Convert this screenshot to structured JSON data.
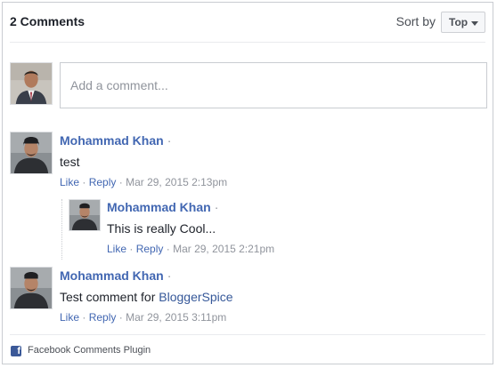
{
  "header": {
    "count_label": "2 Comments",
    "sort_by_label": "Sort by",
    "sort_selected": "Top"
  },
  "composer": {
    "placeholder": "Add a comment..."
  },
  "comments": [
    {
      "author": "Mohammad Khan",
      "separator": "·",
      "text": "test",
      "text_link": "",
      "like": "Like",
      "reply": "Reply",
      "timestamp": "Mar 29, 2015 2:13pm",
      "replies": [
        {
          "author": "Mohammad Khan",
          "separator": "·",
          "text": "This is really Cool...",
          "like": "Like",
          "reply": "Reply",
          "timestamp": "Mar 29, 2015 2:21pm"
        }
      ]
    },
    {
      "author": "Mohammad Khan",
      "separator": "·",
      "text": "Test comment for ",
      "text_link": "BloggerSpice",
      "like": "Like",
      "reply": "Reply",
      "timestamp": "Mar 29, 2015 3:11pm",
      "replies": []
    }
  ],
  "footer": {
    "plugin_label": "Facebook Comments Plugin",
    "icon": "facebook-icon"
  },
  "colors": {
    "link": "#4267b2",
    "meta": "#90949c",
    "border": "#c9ccd1",
    "facebook_blue": "#3b5998"
  }
}
